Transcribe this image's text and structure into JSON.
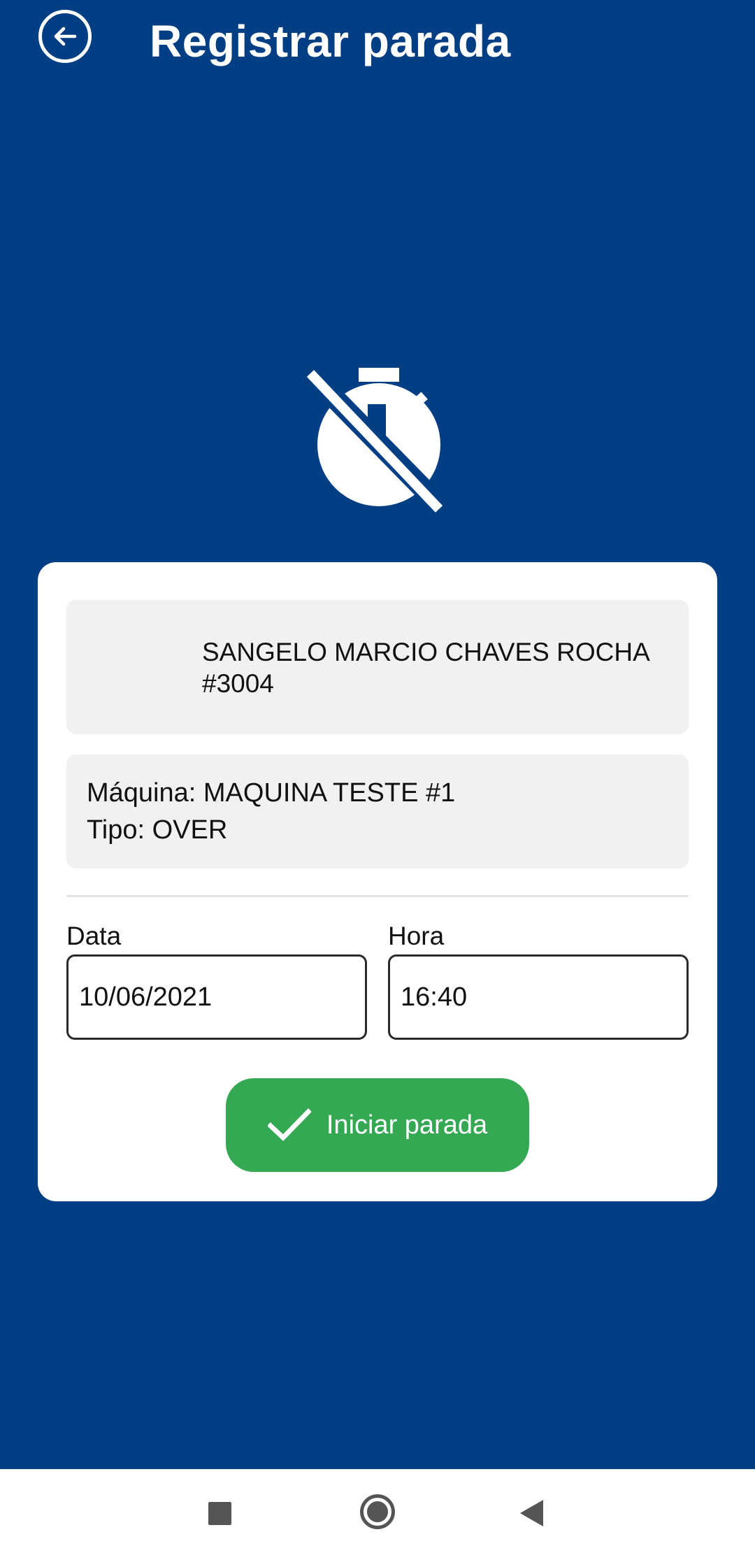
{
  "header": {
    "title": "Registrar parada",
    "back_icon": "arrow-left-circle-icon"
  },
  "hero": {
    "icon": "timer-off-icon"
  },
  "user": {
    "name": "SANGELO MARCIO CHAVES ROCHA",
    "id": "#3004"
  },
  "machine": {
    "machine_line": "Máquina: MAQUINA TESTE #1",
    "type_line": "Tipo: OVER"
  },
  "form": {
    "date_label": "Data",
    "date_value": "10/06/2021",
    "time_label": "Hora",
    "time_value": "16:40"
  },
  "actions": {
    "start_label": "Iniciar parada",
    "start_icon": "check-icon"
  },
  "navbar": {
    "recents_icon": "square-icon",
    "home_icon": "circle-icon",
    "back_icon": "triangle-back-icon"
  },
  "colors": {
    "background": "#013E83",
    "card": "#FFFFFF",
    "panel": "#F1F1F1",
    "accent_green": "#34A853",
    "text": "#111111"
  }
}
